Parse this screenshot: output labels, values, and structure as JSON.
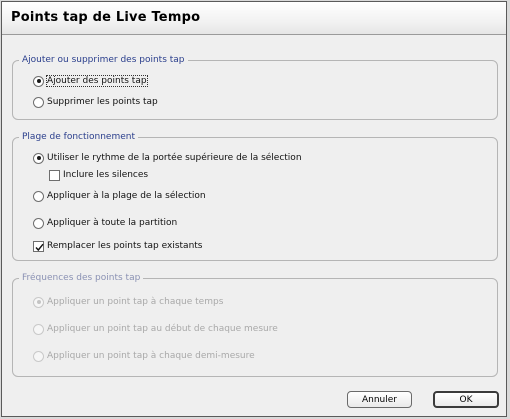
{
  "window": {
    "title": "Points tap de Live Tempo"
  },
  "group_add": {
    "legend": "Ajouter ou supprimer des points tap",
    "add_label": "Ajouter des points tap",
    "remove_label": "Supprimer les points tap"
  },
  "group_range": {
    "legend": "Plage de fonctionnement",
    "rhythm_label": "Utiliser le rythme de la portée supérieure de la sélection",
    "silences_label": "Inclure les silences",
    "selection_label": "Appliquer à la plage de la sélection",
    "whole_label": "Appliquer à toute la partition",
    "replace_label": "Remplacer les points tap existants"
  },
  "group_freq": {
    "legend": "Fréquences des points tap",
    "each_beat_label": "Appliquer un point tap à chaque temps",
    "measure_start_label": "Appliquer un point tap au début de chaque mesure",
    "half_measure_label": "Appliquer un point tap à chaque demi-mesure"
  },
  "buttons": {
    "cancel": "Annuler",
    "ok": "OK"
  },
  "state": {
    "add_remove_selected": "add",
    "range_selected": "rhythm",
    "include_silences": false,
    "replace_existing": true,
    "frequency_selected": "each_beat",
    "frequency_enabled": false
  },
  "colors": {
    "legend": "#2a3e8c",
    "disabled_text": "#a9a9a9"
  }
}
